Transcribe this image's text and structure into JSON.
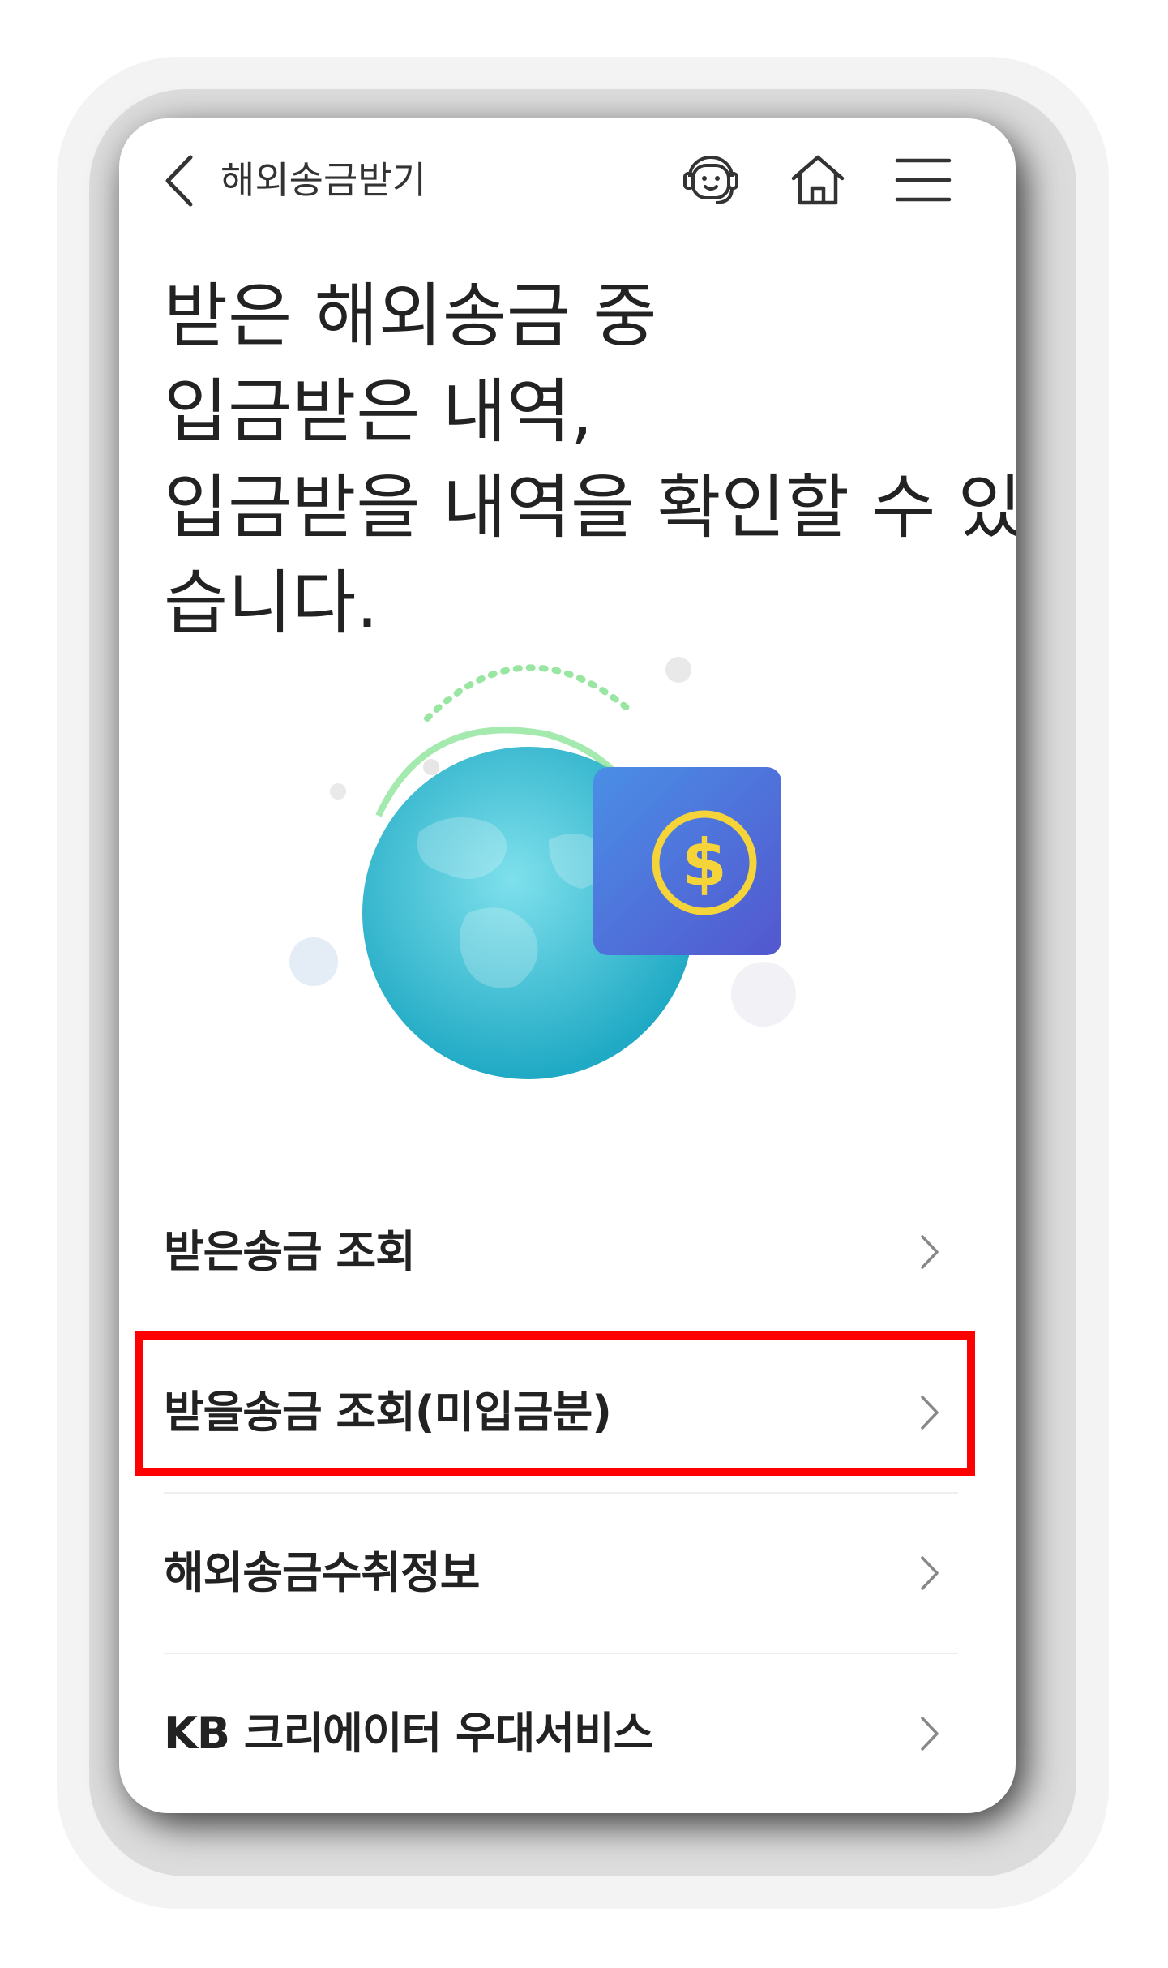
{
  "header": {
    "back_icon": "chevron-left-icon",
    "title": "해외송금받기",
    "chatbot_icon": "chatbot-icon",
    "home_icon": "home-icon",
    "menu_icon": "hamburger-menu-icon"
  },
  "intro": {
    "lines": [
      "받은 해외송금 중",
      "입금받은 내역,",
      "입금받을 내역을 확인할 수 있",
      "습니다."
    ]
  },
  "illustration": {
    "icon": "globe-dollar-icon",
    "colors": {
      "globe": "#3cc2d6",
      "card": "#4b62d8",
      "coin": "#f5d43a",
      "arrow": "#7ee08a"
    }
  },
  "menu": {
    "items": [
      {
        "label": "받은송금 조회",
        "icon": "chevron-right-icon"
      },
      {
        "label": "받을송금 조회(미입금분)",
        "icon": "chevron-right-icon"
      },
      {
        "label": "해외송금수취정보",
        "icon": "chevron-right-icon"
      },
      {
        "label": "KB 크리에이터 우대서비스",
        "icon": "chevron-right-icon"
      }
    ]
  },
  "colors": {
    "highlight": "#ff0000",
    "text": "#222222"
  }
}
